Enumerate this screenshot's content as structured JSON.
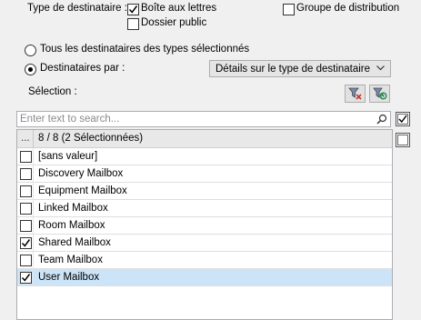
{
  "recipient_type": {
    "label": "Type de destinataire :",
    "mailboxes": {
      "label": "Boîte aux lettres",
      "checked": true
    },
    "public_folder": {
      "label": "Dossier public",
      "checked": false
    },
    "distribution_group": {
      "label": "Groupe de distribution",
      "checked": false
    }
  },
  "scope": {
    "all_recipients_label": "Tous les destinataires des types sélectionnés",
    "all_recipients_selected": false,
    "recipients_by_label": "Destinataires par :",
    "recipients_by_selected": true,
    "recipients_by_value": "Détails sur le type de destinataire"
  },
  "selection": {
    "label": "Sélection :",
    "filter_icon": "filter-delete-icon",
    "refresh_icon": "filter-refresh-icon",
    "search_placeholder": "Enter text to search...",
    "search_value": "",
    "header_dots": "...",
    "header_count": "8 / 8 (2 Sélectionnées)",
    "items": [
      {
        "label": "[sans valeur]",
        "checked": false
      },
      {
        "label": "Discovery Mailbox",
        "checked": false
      },
      {
        "label": "Equipment Mailbox",
        "checked": false
      },
      {
        "label": "Linked Mailbox",
        "checked": false
      },
      {
        "label": "Room Mailbox",
        "checked": false
      },
      {
        "label": "Shared Mailbox",
        "checked": true
      },
      {
        "label": "Team Mailbox",
        "checked": false
      },
      {
        "label": "User Mailbox",
        "checked": true,
        "highlighted": true
      }
    ],
    "select_all_checked": true,
    "clear_all_checked": false
  },
  "colors": {
    "dialog_bg": "#f0f0f0",
    "selected_row": "#cce4f7",
    "radio_on": "#000000",
    "refresh_icon": "#2e8b57"
  }
}
